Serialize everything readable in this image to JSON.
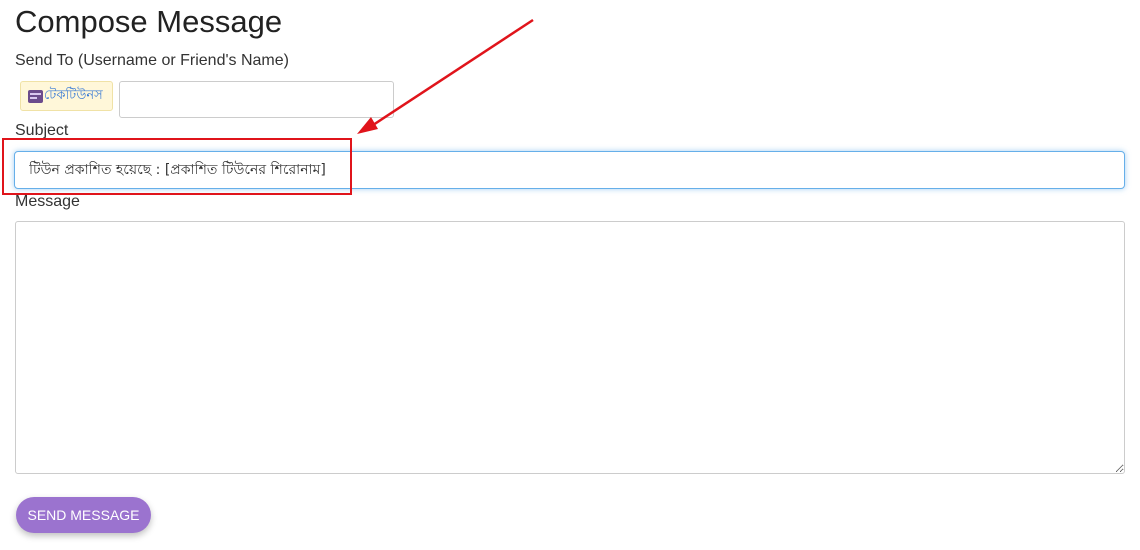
{
  "page": {
    "title": "Compose Message"
  },
  "send_to": {
    "label": "Send To (Username or Friend's Name)",
    "recipient": {
      "name": "টেকটিউনস",
      "avatar_icon": "techtunes-logo-icon"
    },
    "input_value": ""
  },
  "subject": {
    "label": "Subject",
    "value": "টিউন প্রকাশিত হয়েছে : [প্রকাশিত টিউনের শিরোনাম]"
  },
  "message": {
    "label": "Message",
    "value": ""
  },
  "actions": {
    "send_label": "SEND MESSAGE"
  },
  "annotation": {
    "color": "#e0141b"
  },
  "colors": {
    "accent": "#9b73cf",
    "focus_border": "#66afe9",
    "recipient_chip_bg": "#fff7d9"
  }
}
